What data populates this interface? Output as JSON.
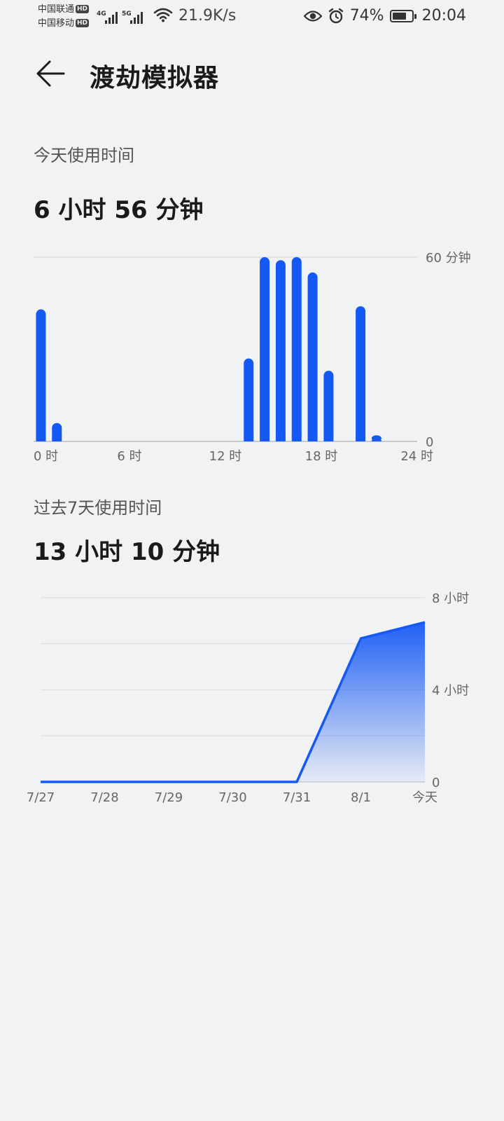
{
  "status_bar": {
    "carrier_1": "中国联通",
    "carrier_2": "中国移动",
    "hd_badge": "HD",
    "signal_1_tag": "4G",
    "signal_2_tag": "5G",
    "net_speed": "21.9K/s",
    "battery_percent": "74%",
    "battery_level": 0.74,
    "time": "20:04",
    "icons": [
      "signal-icon",
      "wifi-icon",
      "eye-icon",
      "alarm-icon",
      "battery-icon"
    ]
  },
  "header": {
    "title": "渡劫模拟器",
    "back_icon": "arrow-left-icon"
  },
  "today": {
    "label": "今天使用时间",
    "value": "6 小时 56 分钟"
  },
  "week": {
    "label": "过去7天使用时间",
    "value": "13 小时 10 分钟"
  },
  "colors": {
    "accent": "#1559f5",
    "background": "#f1f2f4"
  },
  "chart_data": [
    {
      "type": "bar",
      "title": "",
      "xlabel": "",
      "ylabel": "",
      "x_unit": "hour",
      "x_tick_labels": [
        "0 时",
        "6 时",
        "12 时",
        "18 时",
        "24 时"
      ],
      "y_tick_labels": [
        "60 分钟",
        "0"
      ],
      "ylim": [
        0,
        60
      ],
      "categories": [
        0,
        1,
        13,
        14,
        15,
        16,
        17,
        18,
        20,
        21
      ],
      "values": [
        43,
        6,
        27,
        60,
        59,
        60,
        55,
        23,
        44,
        2
      ],
      "grid": true,
      "legend": "none"
    },
    {
      "type": "area",
      "title": "",
      "xlabel": "",
      "ylabel": "",
      "categories": [
        "7/27",
        "7/28",
        "7/29",
        "7/30",
        "7/31",
        "8/1",
        "今天"
      ],
      "values": [
        0,
        0,
        0,
        0,
        0,
        6.23,
        6.93
      ],
      "ylim": [
        0,
        8
      ],
      "y_tick_labels": [
        "8 小时",
        "4 小时",
        "0"
      ],
      "grid": true,
      "legend": "none"
    }
  ]
}
